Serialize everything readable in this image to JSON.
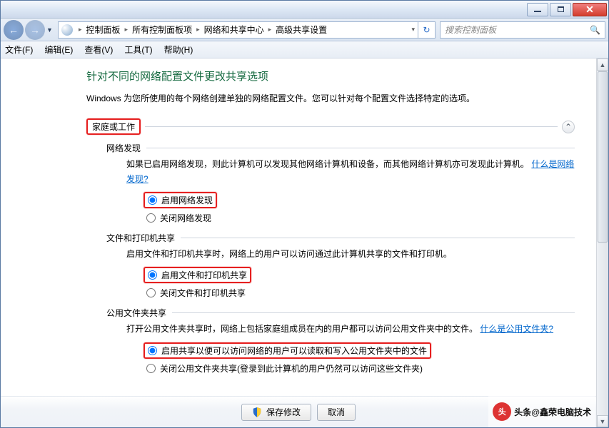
{
  "titlebar": {
    "min_icon": "minimize-icon",
    "max_icon": "maximize-icon",
    "close_icon": "close-icon"
  },
  "breadcrumbs": {
    "root": "控制面板",
    "items": "所有控制面板项",
    "net": "网络和共享中心",
    "adv": "高级共享设置"
  },
  "search": {
    "placeholder": "搜索控制面板"
  },
  "menu": {
    "file": "文件(F)",
    "edit": "编辑(E)",
    "view": "查看(V)",
    "tools": "工具(T)",
    "help": "帮助(H)"
  },
  "page": {
    "heading": "针对不同的网络配置文件更改共享选项",
    "desc": "Windows 为您所使用的每个网络创建单独的网络配置文件。您可以针对每个配置文件选择特定的选项。",
    "profile": "家庭或工作"
  },
  "nd": {
    "title": "网络发现",
    "body_a": "如果已启用网络发现，则此计算机可以发现其他网络计算机和设备，而其他网络计算机亦可发现此计算机。",
    "link": "什么是网络发现?",
    "opt_on": "启用网络发现",
    "opt_off": "关闭网络发现"
  },
  "fp": {
    "title": "文件和打印机共享",
    "body": "启用文件和打印机共享时，网络上的用户可以访问通过此计算机共享的文件和打印机。",
    "opt_on": "启用文件和打印机共享",
    "opt_off": "关闭文件和打印机共享"
  },
  "pf": {
    "title": "公用文件夹共享",
    "body_a": "打开公用文件夹共享时，网络上包括家庭组成员在内的用户都可以访问公用文件夹中的文件。",
    "link": "什么是公用文件夹?",
    "opt_on": "启用共享以便可以访问网络的用户可以读取和写入公用文件夹中的文件",
    "opt_off": "关闭公用文件夹共享(登录到此计算机的用户仍然可以访问这些文件夹)"
  },
  "footer": {
    "save": "保存修改",
    "cancel": "取消"
  },
  "watermark": {
    "text": "头条@鑫荣电脑技术"
  }
}
